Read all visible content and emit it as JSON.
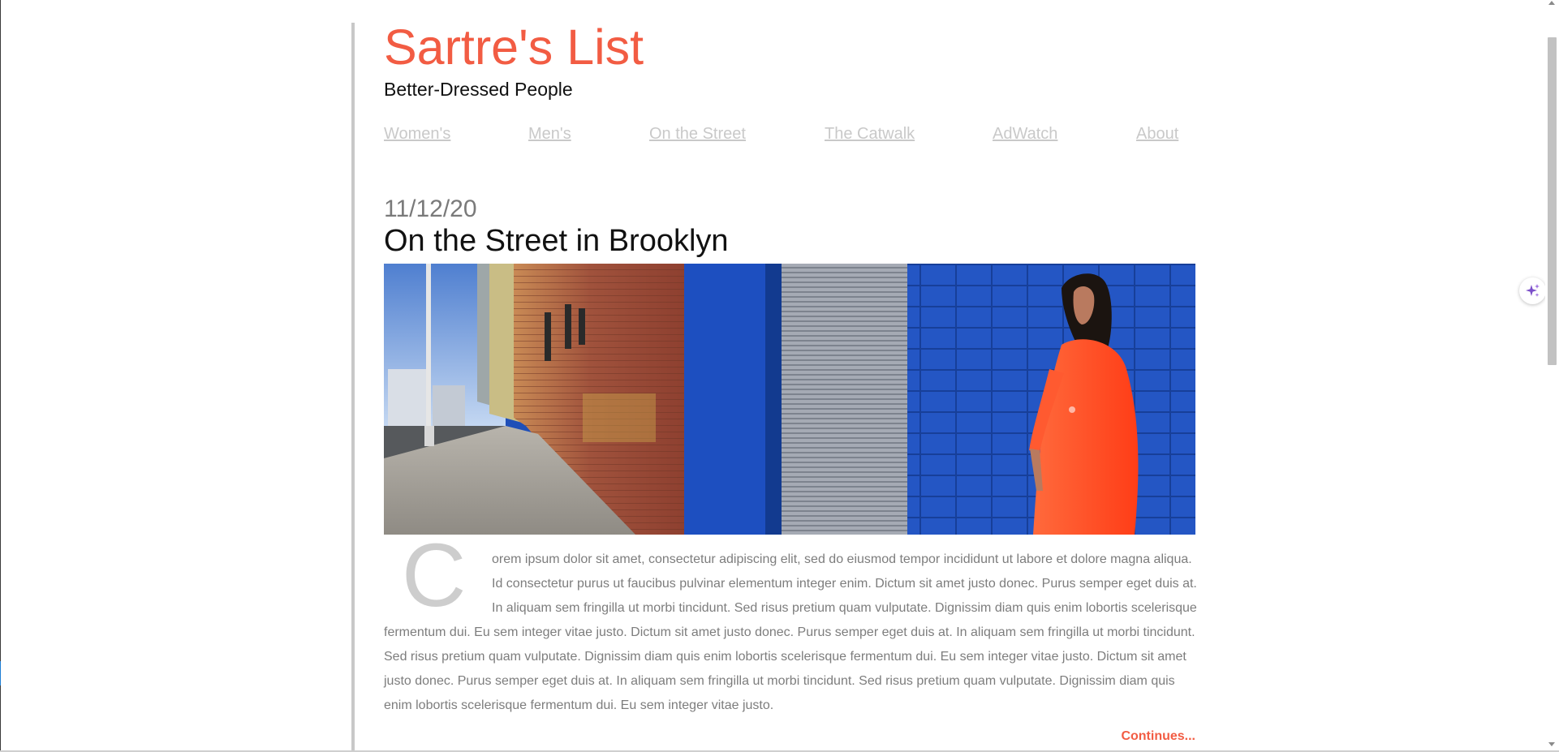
{
  "site": {
    "title": "Sartre's List",
    "tagline": "Better-Dressed People"
  },
  "nav": {
    "items": [
      {
        "label": "Women's"
      },
      {
        "label": "Men's"
      },
      {
        "label": "On the Street"
      },
      {
        "label": "The Catwalk"
      },
      {
        "label": "AdWatch"
      },
      {
        "label": "About"
      }
    ]
  },
  "post": {
    "date": "11/12/20",
    "title": "On the Street in Brooklyn",
    "drop_cap": "C",
    "body": "orem ipsum dolor sit amet, consectetur adipiscing elit, sed do eiusmod tempor incididunt ut labore et dolore magna aliqua. Id consectetur purus ut faucibus pulvinar elementum integer enim. Dictum sit amet justo donec. Purus semper eget duis at. In aliquam sem fringilla ut morbi tincidunt. Sed risus pretium quam vulputate. Dignissim diam quis enim lobortis scelerisque fermentum dui. Eu sem integer vitae justo. Dictum sit amet justo donec. Purus semper eget duis at. In aliquam sem fringilla ut morbi tincidunt. Sed risus pretium quam vulputate. Dignissim diam quis enim lobortis scelerisque fermentum dui. Eu sem integer vitae justo. Dictum sit amet justo donec. Purus semper eget duis at. In aliquam sem fringilla ut morbi tincidunt. Sed risus pretium quam vulputate. Dignissim diam quis enim lobortis scelerisque fermentum dui. Eu sem integer vitae justo.",
    "continue_label": "Continues..."
  },
  "colors": {
    "accent": "#f25c43",
    "nav_link": "#c9c9c9",
    "body_text": "#7d7d7d",
    "date_text": "#7a7a7a"
  },
  "icons": {
    "ai_assistant": "sparkle-icon"
  }
}
